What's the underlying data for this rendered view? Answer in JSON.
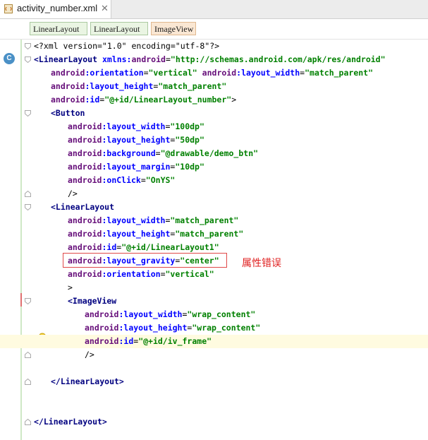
{
  "tab": {
    "filename": "activity_number.xml",
    "close": "✕"
  },
  "breadcrumb": [
    "LinearLayout",
    "LinearLayout",
    "ImageView"
  ],
  "gutter": {
    "class_badge": "C"
  },
  "annotation": "属性错误",
  "colors": {
    "tag": "#000080",
    "namespace": "#660e7a",
    "attr": "#0000ff",
    "value": "#008000",
    "warning": "#e02020",
    "highlight_line": "#fffbe0"
  },
  "code": [
    {
      "indent": 0,
      "parts": [
        [
          "pi",
          "<?xml version=\"1.0\" encoding=\"utf-8\"?>"
        ]
      ]
    },
    {
      "indent": 0,
      "parts": [
        [
          "tg",
          "<LinearLayout "
        ],
        [
          "an",
          "xmlns:"
        ],
        [
          "ns",
          "android"
        ],
        [
          "pl",
          "="
        ],
        [
          "av",
          "\"http://schemas.android.com/apk/res/android\""
        ]
      ]
    },
    {
      "indent": 1,
      "parts": [
        [
          "ns",
          "android"
        ],
        [
          "an",
          ":orientation"
        ],
        [
          "pl",
          "="
        ],
        [
          "av",
          "\"vertical\" "
        ],
        [
          "ns",
          "android"
        ],
        [
          "an",
          ":layout_width"
        ],
        [
          "pl",
          "="
        ],
        [
          "av",
          "\"match_parent\""
        ]
      ]
    },
    {
      "indent": 1,
      "parts": [
        [
          "ns",
          "android"
        ],
        [
          "an",
          ":layout_height"
        ],
        [
          "pl",
          "="
        ],
        [
          "av",
          "\"match_parent\""
        ]
      ]
    },
    {
      "indent": 1,
      "parts": [
        [
          "ns",
          "android"
        ],
        [
          "an",
          ":id"
        ],
        [
          "pl",
          "="
        ],
        [
          "av",
          "\"@+id/LinearLayout_number\""
        ],
        [
          "pl",
          ">"
        ]
      ]
    },
    {
      "indent": 1,
      "parts": [
        [
          "tg",
          "<Button"
        ]
      ]
    },
    {
      "indent": 2,
      "parts": [
        [
          "ns",
          "android"
        ],
        [
          "an",
          ":layout_width"
        ],
        [
          "pl",
          "="
        ],
        [
          "av",
          "\"100dp\""
        ]
      ]
    },
    {
      "indent": 2,
      "parts": [
        [
          "ns",
          "android"
        ],
        [
          "an",
          ":layout_height"
        ],
        [
          "pl",
          "="
        ],
        [
          "av",
          "\"50dp\""
        ]
      ]
    },
    {
      "indent": 2,
      "parts": [
        [
          "ns",
          "android"
        ],
        [
          "an",
          ":background"
        ],
        [
          "pl",
          "="
        ],
        [
          "av",
          "\"@drawable/demo_btn\""
        ]
      ]
    },
    {
      "indent": 2,
      "parts": [
        [
          "ns",
          "android"
        ],
        [
          "an",
          ":layout_margin"
        ],
        [
          "pl",
          "="
        ],
        [
          "av",
          "\"10dp\""
        ]
      ]
    },
    {
      "indent": 2,
      "parts": [
        [
          "ns",
          "android"
        ],
        [
          "an",
          ":onClick"
        ],
        [
          "pl",
          "="
        ],
        [
          "av",
          "\"OnYS\""
        ]
      ]
    },
    {
      "indent": 2,
      "parts": [
        [
          "pl",
          "/>"
        ]
      ]
    },
    {
      "indent": 1,
      "parts": [
        [
          "tg",
          "<LinearLayout"
        ]
      ]
    },
    {
      "indent": 2,
      "parts": [
        [
          "ns",
          "android"
        ],
        [
          "an",
          ":layout_width"
        ],
        [
          "pl",
          "="
        ],
        [
          "av",
          "\"match_parent\""
        ]
      ]
    },
    {
      "indent": 2,
      "parts": [
        [
          "ns",
          "android"
        ],
        [
          "an",
          ":layout_height"
        ],
        [
          "pl",
          "="
        ],
        [
          "av",
          "\"match_parent\""
        ]
      ]
    },
    {
      "indent": 2,
      "parts": [
        [
          "ns",
          "android"
        ],
        [
          "an",
          ":id"
        ],
        [
          "pl",
          "="
        ],
        [
          "av",
          "\"@+id/LinearLayout1\""
        ]
      ]
    },
    {
      "indent": 2,
      "parts": [
        [
          "ns",
          "android"
        ],
        [
          "an",
          ":layout_gravity"
        ],
        [
          "pl",
          "="
        ],
        [
          "av",
          "\"center\""
        ]
      ]
    },
    {
      "indent": 2,
      "parts": [
        [
          "ns",
          "android"
        ],
        [
          "an",
          ":orientation"
        ],
        [
          "pl",
          "="
        ],
        [
          "av",
          "\"vertical\""
        ]
      ]
    },
    {
      "indent": 2,
      "parts": [
        [
          "pl",
          ">"
        ]
      ]
    },
    {
      "indent": 2,
      "parts": [
        [
          "tg",
          "<ImageView"
        ]
      ]
    },
    {
      "indent": 3,
      "parts": [
        [
          "ns",
          "android"
        ],
        [
          "an",
          ":layout_width"
        ],
        [
          "pl",
          "="
        ],
        [
          "av",
          "\"wrap_content\""
        ]
      ]
    },
    {
      "indent": 3,
      "parts": [
        [
          "ns",
          "android"
        ],
        [
          "an",
          ":layout_height"
        ],
        [
          "pl",
          "="
        ],
        [
          "av",
          "\"wrap_content\""
        ]
      ]
    },
    {
      "indent": 3,
      "highlight": true,
      "parts": [
        [
          "ns",
          "android"
        ],
        [
          "an",
          ":id"
        ],
        [
          "pl",
          "="
        ],
        [
          "av",
          "\"@+id/iv_frame\""
        ]
      ]
    },
    {
      "indent": 3,
      "parts": [
        [
          "pl",
          "/>"
        ]
      ]
    },
    {
      "indent": 0,
      "parts": []
    },
    {
      "indent": 1,
      "parts": [
        [
          "tg",
          "</LinearLayout>"
        ]
      ]
    },
    {
      "indent": 0,
      "parts": []
    },
    {
      "indent": 0,
      "parts": []
    },
    {
      "indent": 0,
      "parts": [
        [
          "tg",
          "</LinearLayout>"
        ]
      ]
    }
  ]
}
